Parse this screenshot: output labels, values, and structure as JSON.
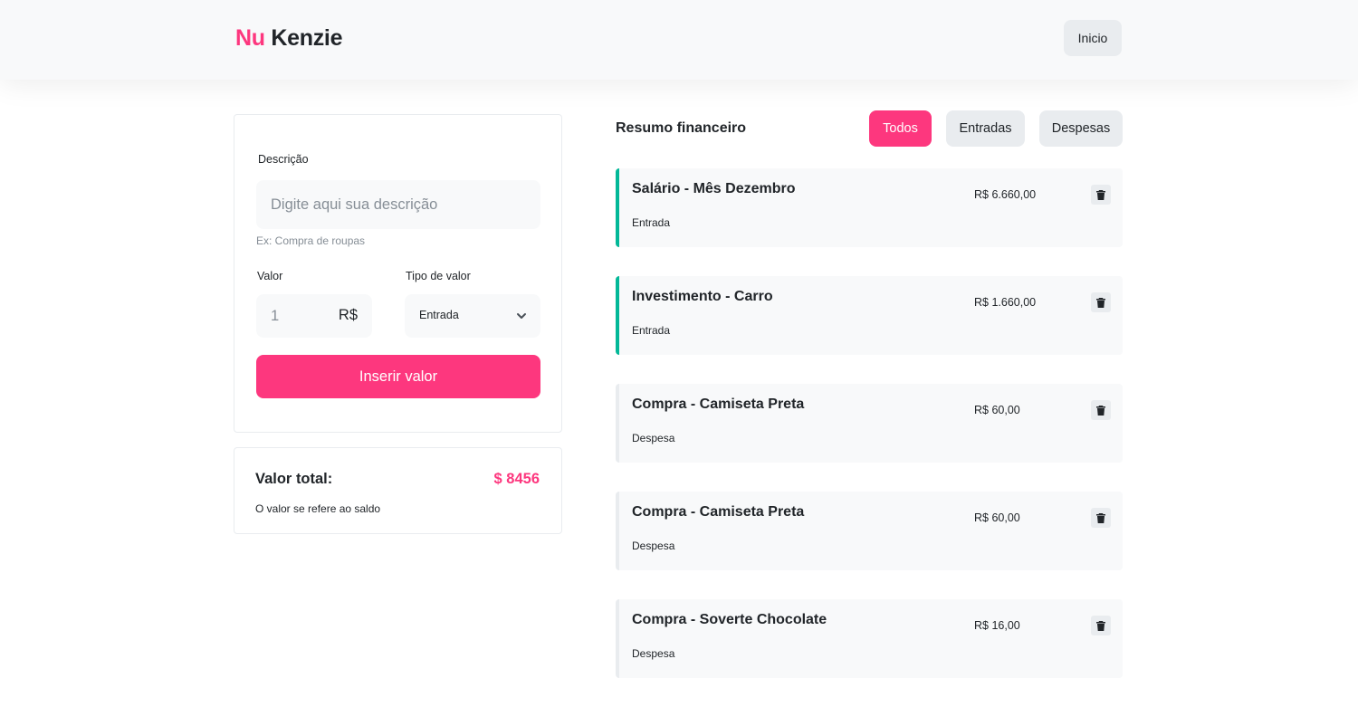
{
  "header": {
    "logo_nu": "Nu",
    "logo_kenzie": "Kenzie",
    "home_button": "Inicio",
    "colors": {
      "brand": "#fd377e",
      "background": "#f8f9fa"
    }
  },
  "form": {
    "description_label": "Descrição",
    "description_placeholder": "Digite aqui sua descrição",
    "description_hint": "Ex: Compra de roupas",
    "value_label": "Valor",
    "value_input": "1",
    "value_currency": "R$",
    "type_label": "Tipo de valor",
    "type_selected": "Entrada",
    "type_icon": "chevron-down-icon",
    "submit_label": "Inserir valor"
  },
  "total": {
    "label": "Valor total:",
    "value": "$ 8456",
    "subtitle": "O valor se refere ao saldo"
  },
  "summary": {
    "title": "Resumo financeiro",
    "filters": [
      {
        "label": "Todos",
        "active": true
      },
      {
        "label": "Entradas",
        "active": false
      },
      {
        "label": "Despesas",
        "active": false
      }
    ],
    "transactions": [
      {
        "title": "Salário - Mês Dezembro",
        "amount": "R$ 6.660,00",
        "type": "Entrada"
      },
      {
        "title": "Investimento - Carro",
        "amount": "R$ 1.660,00",
        "type": "Entrada"
      },
      {
        "title": "Compra - Camiseta Preta",
        "amount": "R$ 60,00",
        "type": "Despesa"
      },
      {
        "title": "Compra - Camiseta Preta",
        "amount": "R$ 60,00",
        "type": "Despesa"
      },
      {
        "title": "Compra - Soverte Chocolate",
        "amount": "R$ 16,00",
        "type": "Despesa"
      }
    ],
    "delete_icon": "trash-icon",
    "colors": {
      "entrada": "#03b898",
      "despesa": "#e9ecef"
    }
  }
}
